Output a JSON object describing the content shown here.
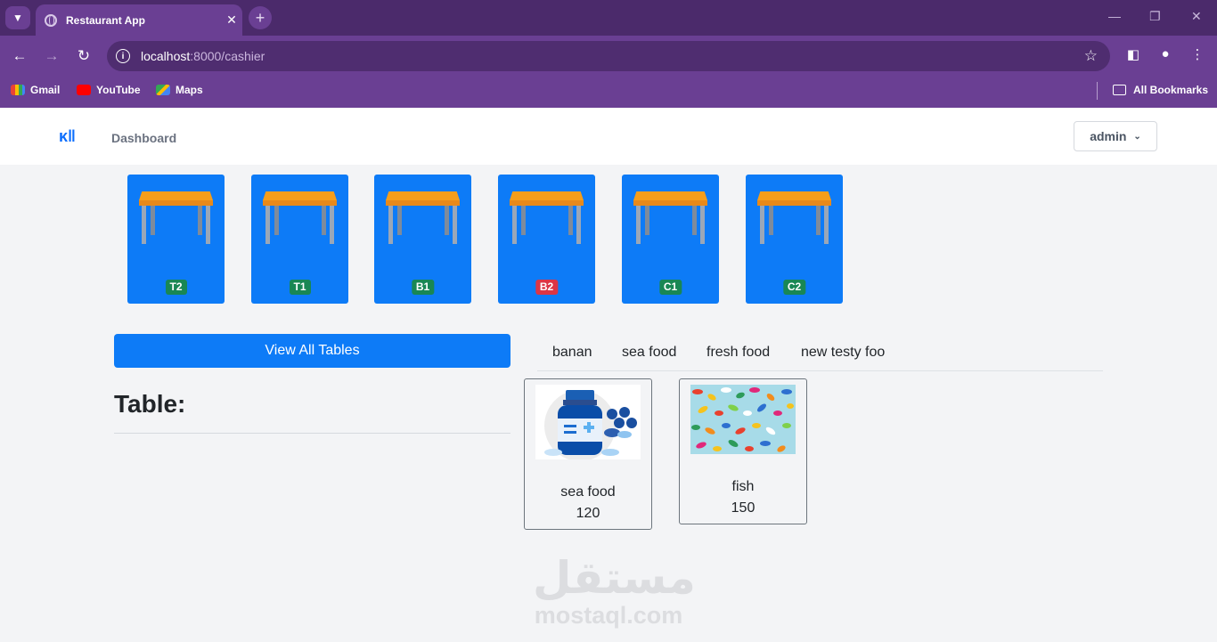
{
  "browser": {
    "tab_title": "Restaurant App",
    "url_host": "localhost",
    "url_path": ":8000/cashier",
    "bookmarks": [
      "Gmail",
      "YouTube",
      "Maps"
    ],
    "all_bookmarks": "All Bookmarks",
    "icons": [
      "tab-search-icon",
      "globe-icon",
      "close-icon",
      "plus-icon",
      "minimize-icon",
      "restore-icon",
      "back-arrow-icon",
      "forward-arrow-icon",
      "reload-icon",
      "info-icon",
      "star-icon",
      "sidebar-icon",
      "profile-icon",
      "menu-dots-icon",
      "folder-icon"
    ]
  },
  "navbar": {
    "brand_icon": "utensils-icon",
    "dashboard_label": "Dashboard",
    "user_label": "admin",
    "accent": "#0d6efd"
  },
  "tables": [
    {
      "label": "T2",
      "status": "available",
      "color": "#198754"
    },
    {
      "label": "T1",
      "status": "available",
      "color": "#198754"
    },
    {
      "label": "B1",
      "status": "available",
      "color": "#198754"
    },
    {
      "label": "B2",
      "status": "occupied",
      "color": "#dc3545"
    },
    {
      "label": "C1",
      "status": "available",
      "color": "#198754"
    },
    {
      "label": "C2",
      "status": "available",
      "color": "#198754"
    }
  ],
  "left_panel": {
    "view_all_label": "View All Tables",
    "table_heading": "Table:"
  },
  "categories": [
    "banan",
    "sea food",
    "fresh food",
    "new testy foo"
  ],
  "products": [
    {
      "name": "sea food",
      "price": "120",
      "image": "medicine-bottle-image"
    },
    {
      "name": "fish",
      "price": "150",
      "image": "colorful-pills-image"
    }
  ],
  "watermark": {
    "arabic": "مستقل",
    "latin": "mostaql.com"
  }
}
